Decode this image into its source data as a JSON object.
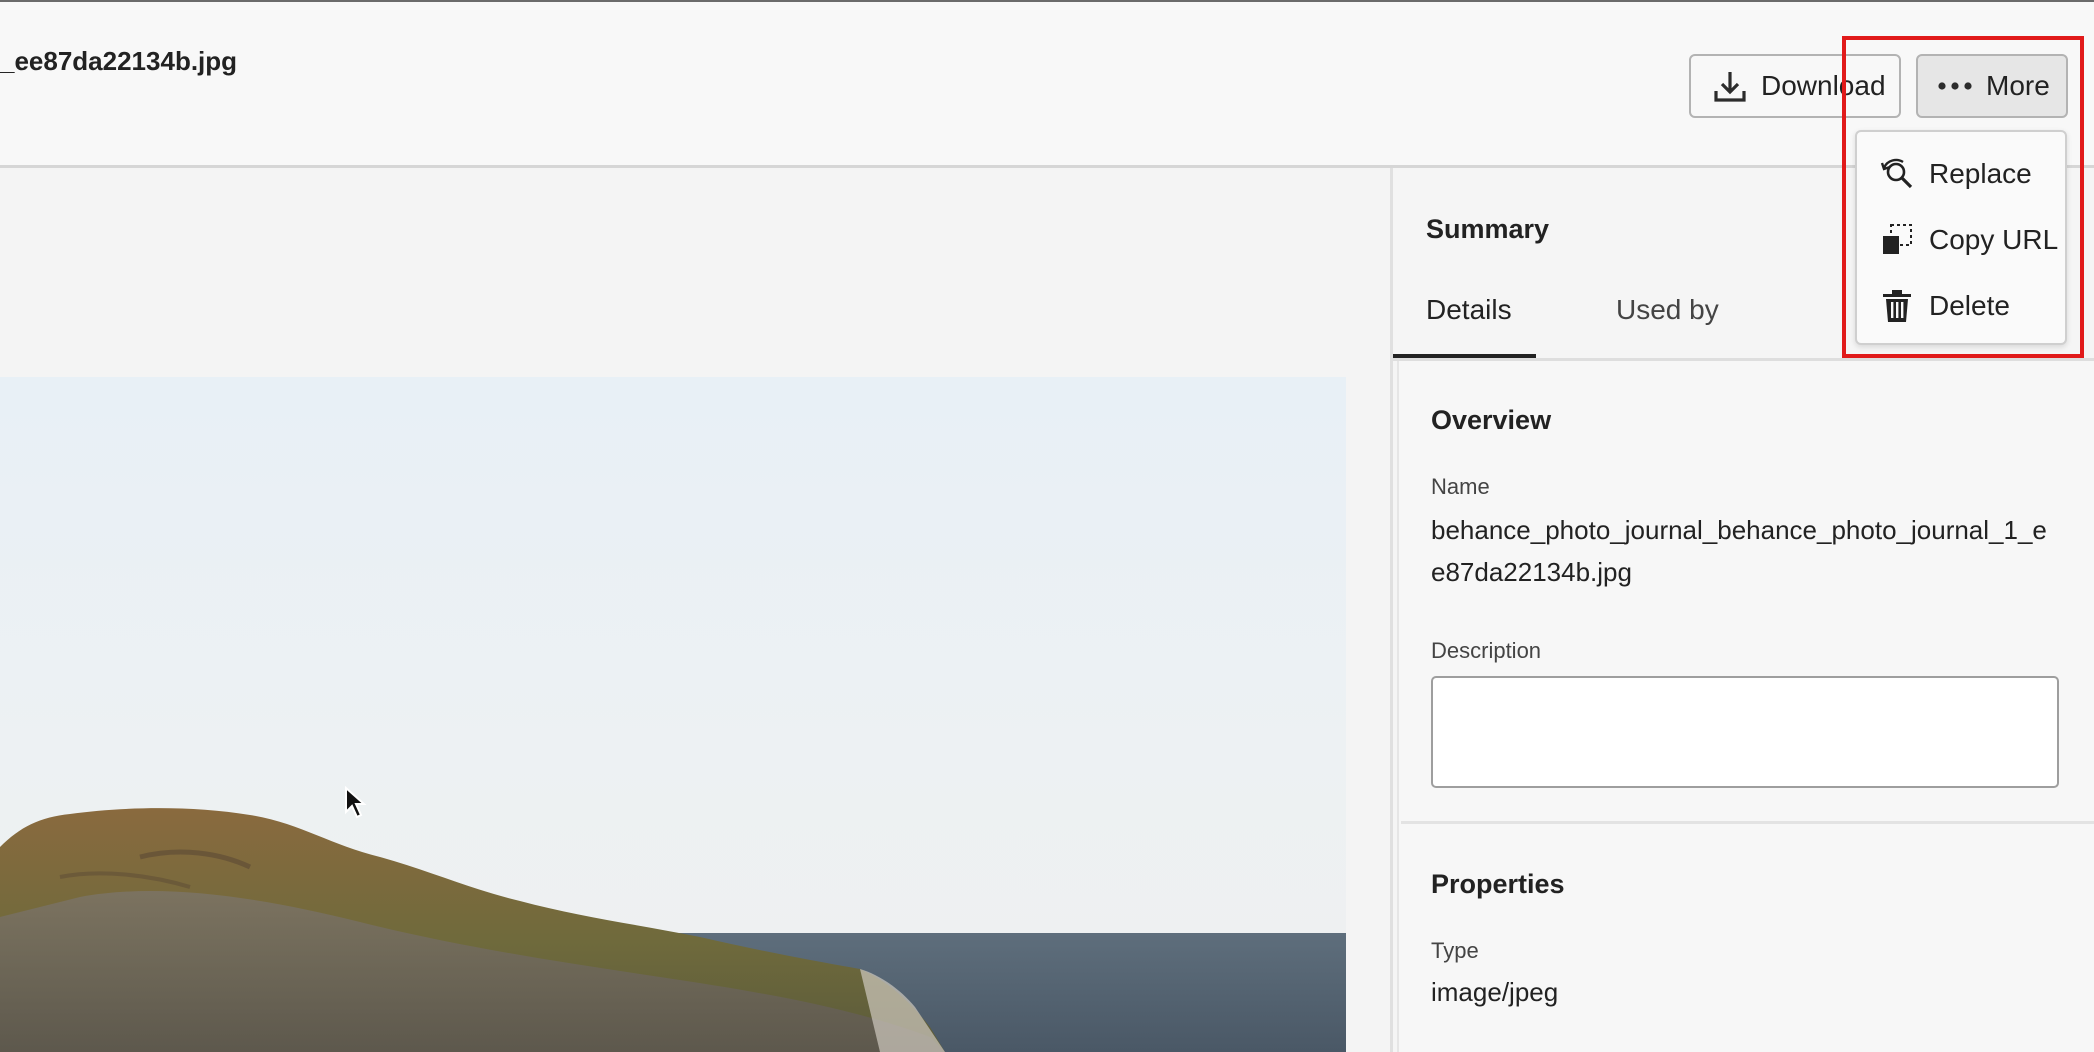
{
  "header": {
    "file_title": "_ee87da22134b.jpg",
    "download_label": "Download",
    "more_label": "More"
  },
  "menu": {
    "items": [
      {
        "label": "Replace",
        "icon": "replace-icon"
      },
      {
        "label": "Copy URL",
        "icon": "copy-url-icon"
      },
      {
        "label": "Delete",
        "icon": "trash-icon"
      }
    ]
  },
  "panel": {
    "summary_title": "Summary",
    "tabs": [
      {
        "label": "Details",
        "selected": true
      },
      {
        "label": "Used by",
        "selected": false
      }
    ],
    "overview": {
      "title": "Overview",
      "name_label": "Name",
      "name_value": "behance_photo_journal_behance_photo_journal_1_ee87da22134b.jpg",
      "description_label": "Description",
      "description_value": ""
    },
    "properties": {
      "title": "Properties",
      "type_label": "Type",
      "type_value": "image/jpeg"
    }
  },
  "colors": {
    "highlight": "#e11a1a",
    "tab_underline": "#222222"
  }
}
